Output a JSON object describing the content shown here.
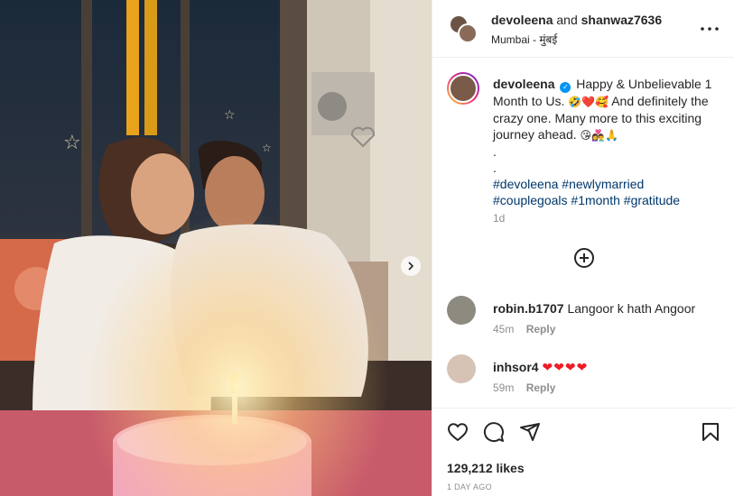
{
  "header": {
    "user1": "devoleena",
    "connector": "and",
    "user2": "shanwaz7636",
    "location": "Mumbai - मुंबई"
  },
  "caption": {
    "username": "devoleena",
    "verified_badge": "✓",
    "text_1": "Happy & Unbelievable 1 Month to Us.",
    "emoji_1": "🤣❤️🥰",
    "text_2": "And definitely the crazy one. Many more to this exciting journey ahead.",
    "emoji_2": "😘👩‍❤️‍👨🙏",
    "dot_1": ".",
    "dot_2": ".",
    "hashtags": [
      "#devoleena",
      "#newlymarried",
      "#couplegoals",
      "#1month",
      "#gratitude"
    ],
    "age": "1d"
  },
  "comments": [
    {
      "username": "robin.b1707",
      "text": "Langoor k hath Angoor",
      "time": "45m",
      "reply": "Reply"
    },
    {
      "username": "inhsor4",
      "text": "❤❤❤❤",
      "time": "59m",
      "reply": "Reply"
    }
  ],
  "footer": {
    "likes": "129,212 likes",
    "posted": "1 DAY AGO"
  },
  "icons": {
    "more": "more-options-icon",
    "load_more": "plus-circle-icon",
    "like": "heart-icon",
    "comment": "comment-icon",
    "share": "share-icon",
    "save": "bookmark-icon",
    "next": "chevron-right-icon"
  },
  "colors": {
    "link": "#00376b",
    "muted": "#8e8e8e",
    "verified": "#0095f6",
    "heart": "#ed1c24"
  }
}
